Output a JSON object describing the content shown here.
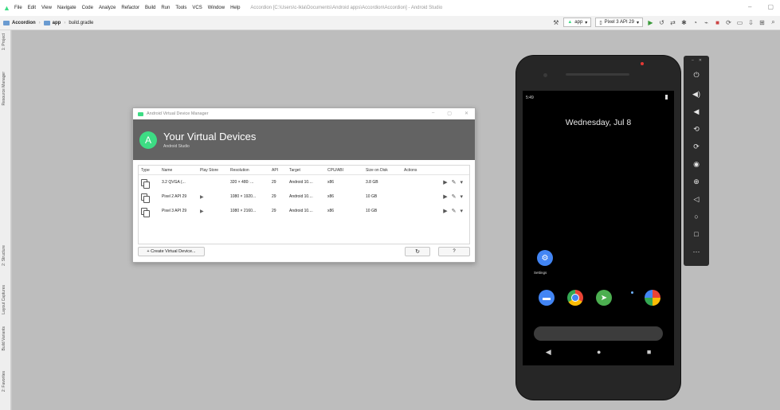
{
  "window": {
    "title": "Accordion [C:\\Users\\c-lkla\\Documents\\Android apps\\Accordion\\Accordion] - Android Studio",
    "controls": [
      "–",
      "▢"
    ]
  },
  "menu": [
    "File",
    "Edit",
    "View",
    "Navigate",
    "Code",
    "Analyze",
    "Refactor",
    "Build",
    "Run",
    "Tools",
    "VCS",
    "Window",
    "Help"
  ],
  "breadcrumbs": [
    "Accordion",
    "app",
    "build.gradle"
  ],
  "toolbar": {
    "config_select": "app",
    "device_select": "Pixel 3 API 29"
  },
  "side_tabs": [
    "1: Project",
    "Resource Manager",
    "2: Structure",
    "Layout Captures",
    "Build Variants",
    "2: Favorites"
  ],
  "avd": {
    "title": "Android Virtual Device Manager",
    "header_title": "Your Virtual Devices",
    "header_subtitle": "Android Studio",
    "columns": [
      "Type",
      "Name",
      "Play Store",
      "Resolution",
      "API",
      "Target",
      "CPU/ABI",
      "Size on Disk",
      "Actions"
    ],
    "devices": [
      {
        "name": "3.2 QVGA (...",
        "play_store": "",
        "resolution": "320 × 480: ...",
        "api": "29",
        "target": "Android 10....",
        "cpu": "x86",
        "size": "3.8 GB"
      },
      {
        "name": "Pixel 2 API 29",
        "play_store": "▶",
        "resolution": "1080 × 1920...",
        "api": "29",
        "target": "Android 10....",
        "cpu": "x86",
        "size": "10 GB"
      },
      {
        "name": "Pixel 3 API 29",
        "play_store": "▶",
        "resolution": "1080 × 2160...",
        "api": "29",
        "target": "Android 10....",
        "cpu": "x86",
        "size": "10 GB"
      }
    ],
    "create_button": "+ Create Virtual Device...",
    "refresh_button": "↻",
    "help_button": "?"
  },
  "phone": {
    "time": "5:49",
    "date": "Wednesday, Jul 8",
    "settings_label": "Settings"
  }
}
